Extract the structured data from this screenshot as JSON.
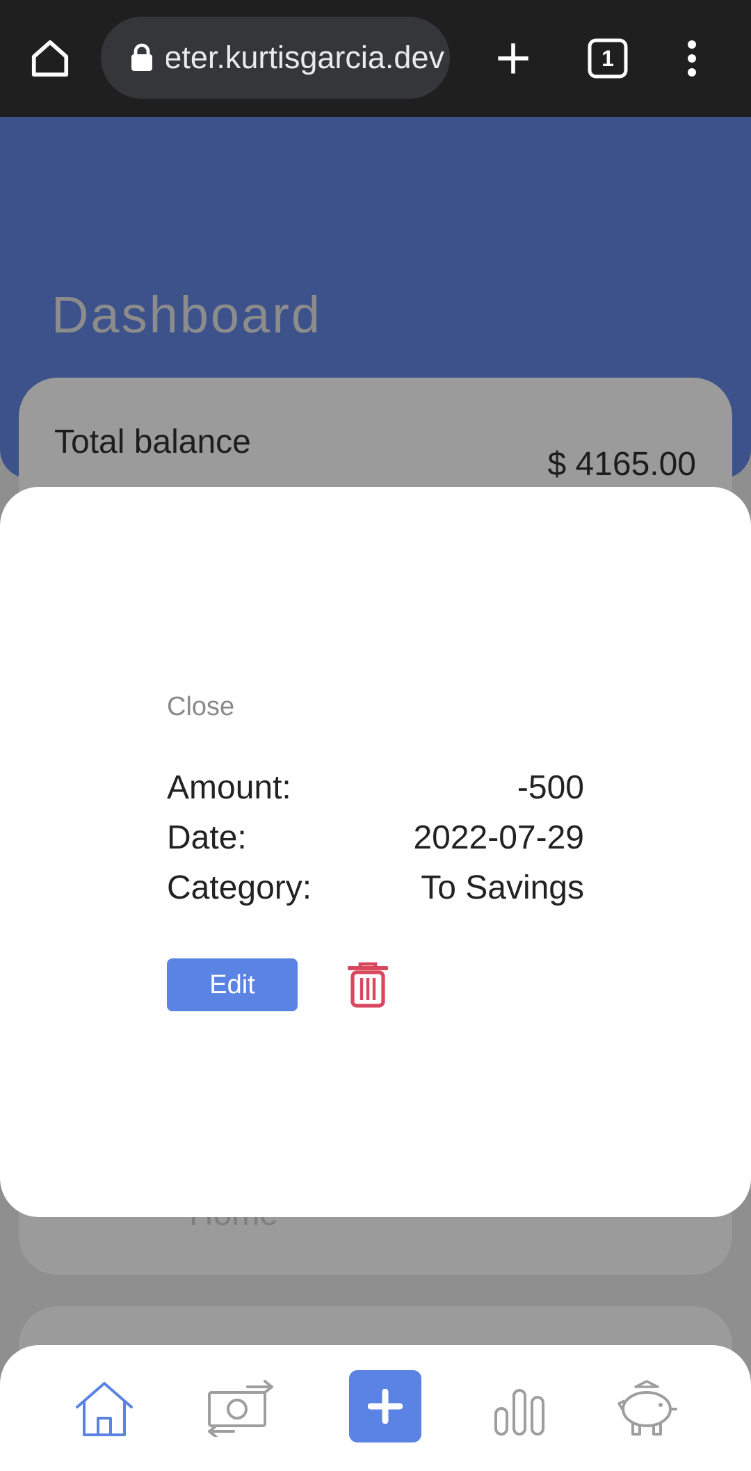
{
  "browser": {
    "url": "budgeter.kurtisgarcia.dev",
    "tab_count": "1"
  },
  "page": {
    "title": "Dashboard",
    "balance_label": "Total balance",
    "balance_value": "$ 4165.00",
    "obscured_row_label": "Home"
  },
  "modal": {
    "close_label": "Close",
    "rows": [
      {
        "label": "Amount:",
        "value": "-500"
      },
      {
        "label": "Date:",
        "value": "2022-07-29"
      },
      {
        "label": "Category:",
        "value": "To Savings"
      }
    ],
    "edit_label": "Edit",
    "delete_icon": "trash-icon"
  },
  "bottom_nav": {
    "items": [
      "home-icon",
      "transactions-icon",
      "add-icon",
      "stats-icon",
      "savings-icon"
    ],
    "active": "home-icon"
  },
  "colors": {
    "header_blue": "#3d528a",
    "accent": "#5b83e3",
    "danger": "#d9475e",
    "inactive_icon": "#9e9e9e"
  }
}
